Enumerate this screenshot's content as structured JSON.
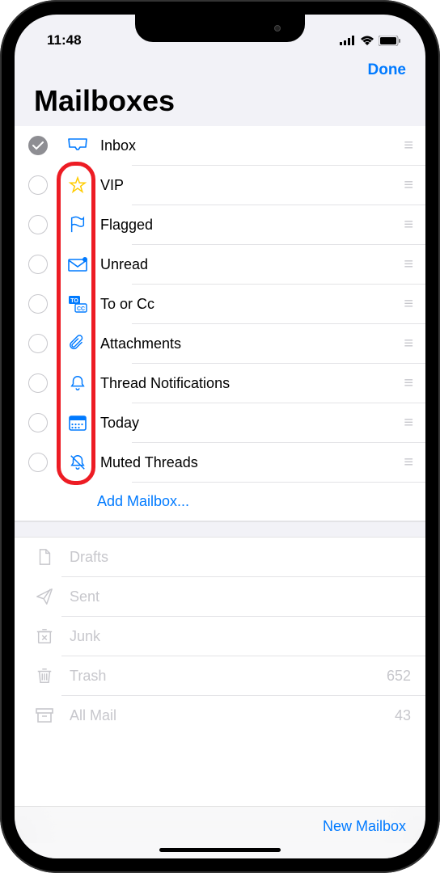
{
  "status": {
    "time": "11:48"
  },
  "nav": {
    "done": "Done"
  },
  "page_title": "Mailboxes",
  "smart_mailboxes": [
    {
      "id": "inbox",
      "label": "Inbox",
      "checked": true,
      "icon": "tray"
    },
    {
      "id": "vip",
      "label": "VIP",
      "checked": false,
      "icon": "star"
    },
    {
      "id": "flagged",
      "label": "Flagged",
      "checked": false,
      "icon": "flag"
    },
    {
      "id": "unread",
      "label": "Unread",
      "checked": false,
      "icon": "envelope-dot"
    },
    {
      "id": "tocc",
      "label": "To or Cc",
      "checked": false,
      "icon": "tocc"
    },
    {
      "id": "attachments",
      "label": "Attachments",
      "checked": false,
      "icon": "paperclip"
    },
    {
      "id": "threadnotif",
      "label": "Thread Notifications",
      "checked": false,
      "icon": "bell"
    },
    {
      "id": "today",
      "label": "Today",
      "checked": false,
      "icon": "calendar"
    },
    {
      "id": "muted",
      "label": "Muted Threads",
      "checked": false,
      "icon": "bell-slash"
    }
  ],
  "add_mailbox": "Add Mailbox...",
  "account_mailboxes": [
    {
      "id": "drafts",
      "label": "Drafts",
      "icon": "doc",
      "count": ""
    },
    {
      "id": "sent",
      "label": "Sent",
      "icon": "paperplane",
      "count": ""
    },
    {
      "id": "junk",
      "label": "Junk",
      "icon": "junk",
      "count": ""
    },
    {
      "id": "trash",
      "label": "Trash",
      "icon": "trash",
      "count": "652"
    },
    {
      "id": "allmail",
      "label": "All Mail",
      "icon": "archive",
      "count": "43"
    }
  ],
  "footer": {
    "new_mailbox": "New Mailbox"
  }
}
